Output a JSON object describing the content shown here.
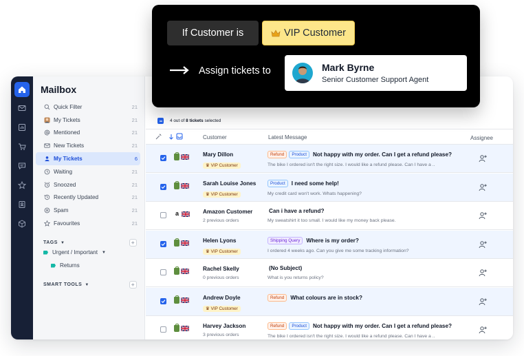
{
  "sidebar": {
    "title": "Mailbox",
    "items": [
      {
        "label": "Quick Filter",
        "count": "21",
        "icon": "search-icon"
      },
      {
        "label": "My Tickets",
        "count": "21",
        "icon": "avatar-icon"
      },
      {
        "label": "Mentioned",
        "count": "21",
        "icon": "at-icon"
      },
      {
        "label": "New Tickets",
        "count": "21",
        "icon": "envelope-icon"
      },
      {
        "label": "My Tickets",
        "count": "6",
        "icon": "user-icon"
      },
      {
        "label": "Waiting",
        "count": "21",
        "icon": "clock-icon"
      },
      {
        "label": "Snoozed",
        "count": "21",
        "icon": "alarm-icon"
      },
      {
        "label": "Recently Updated",
        "count": "21",
        "icon": "history-icon"
      },
      {
        "label": "Spam",
        "count": "21",
        "icon": "spam-icon"
      },
      {
        "label": "Favourites",
        "count": "21",
        "icon": "star-icon"
      }
    ],
    "tags_header": "TAGS",
    "tags": [
      {
        "label": "Urgent / Important"
      },
      {
        "label": "Returns"
      }
    ],
    "smart_tools_header": "SMART TOOLS"
  },
  "list": {
    "selection_prefix": "4 out of ",
    "selection_bold": "8 tickets",
    "selection_suffix": " selected",
    "headers": {
      "customer": "Customer",
      "latest": "Latest Message",
      "assignee": "Assignee"
    },
    "rows": [
      {
        "selected": true,
        "source": "shopify",
        "name": "Mary Dillon",
        "vip": "VIP Customer",
        "sub": "",
        "tags": [
          "Refund",
          "Product"
        ],
        "subject": "Not happy with my order. Can I get a refund please?",
        "preview": "The bike I ordered isn't the right size. I would like a refund please. Can I have a .."
      },
      {
        "selected": true,
        "source": "shopify",
        "name": "Sarah Louise Jones",
        "vip": "VIP Customer",
        "sub": "",
        "tags": [
          "Product"
        ],
        "subject": "I need some help!",
        "preview": "My credit card won't work. Whats happening?"
      },
      {
        "selected": false,
        "source": "amazon",
        "name": "Amazon Customer",
        "vip": "",
        "sub": "2 previous orders",
        "tags": [],
        "subject": "Can i have a refund?",
        "preview": "My sweatshirt it too small. I would like my money back please."
      },
      {
        "selected": true,
        "source": "shopify",
        "name": "Helen Lyons",
        "vip": "VIP Customer",
        "sub": "",
        "tags": [
          "Shipping Query"
        ],
        "subject": "Where is my order?",
        "preview": "I ordered 4 weeks ago. Can you give me some tracking information?"
      },
      {
        "selected": false,
        "source": "shopify",
        "name": "Rachel Skelly",
        "vip": "",
        "sub": "0 previous orders",
        "tags": [],
        "subject": "(No Subject)",
        "preview": "What is you returns policy?"
      },
      {
        "selected": true,
        "source": "shopify",
        "name": "Andrew Doyle",
        "vip": "VIP Customer",
        "sub": "",
        "tags": [
          "Refund"
        ],
        "subject": "What colours are in stock?",
        "preview": ""
      },
      {
        "selected": false,
        "source": "shopify",
        "name": "Harvey Jackson",
        "vip": "",
        "sub": "3 previous orders",
        "tags": [
          "Refund",
          "Product"
        ],
        "subject": "Not happy with my order. Can I get a refund please?",
        "preview": "The bike I ordered isn't the right size. I would like a refund please. Can I have a .."
      }
    ]
  },
  "rule": {
    "condition": "If Customer is",
    "value": "VIP Customer",
    "action": "Assign tickets to",
    "agent_name": "Mark Byrne",
    "agent_role": "Senior Customer Support Agent"
  },
  "colors": {
    "rail": "#172036",
    "accent": "#2563eb",
    "selected_row": "#eff5ff",
    "vip_badge": "#fef3c7",
    "vip_box": "#fde68a"
  }
}
